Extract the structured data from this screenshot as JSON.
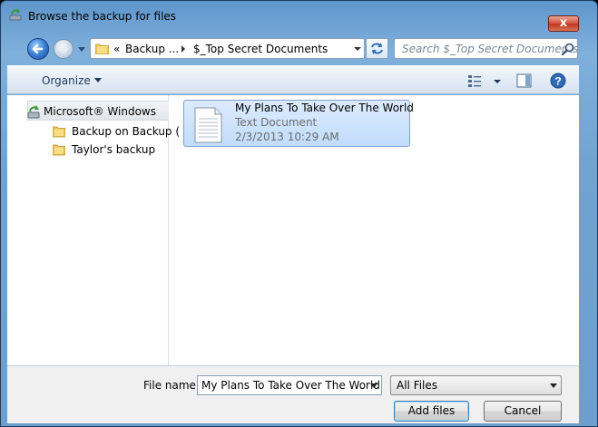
{
  "window": {
    "title": "Browse the backup for files",
    "close_label": "x"
  },
  "address": {
    "overflow": "«",
    "crumbs": [
      "Backup ...",
      "$_Top Secret Documents"
    ]
  },
  "search": {
    "placeholder": "Search $_Top Secret Documents"
  },
  "toolbar": {
    "organize_label": "Organize"
  },
  "nav_pane": {
    "root_label": "Microsoft® Windows",
    "items": [
      {
        "label": "Backup on Backup ("
      },
      {
        "label": "Taylor's backup"
      }
    ]
  },
  "files": [
    {
      "name": "My Plans To Take Over The World",
      "type": "Text Document",
      "date": "2/3/2013 10:29 AM"
    }
  ],
  "footer": {
    "file_name_label": "File name:",
    "file_name_value": "My Plans To Take Over The World",
    "file_type_value": "All Files",
    "add_button": "Add files",
    "cancel_button": "Cancel"
  },
  "colors": {
    "frame": "#6fa3d2",
    "selection": "#c1dcfc",
    "close": "#c0381f"
  }
}
